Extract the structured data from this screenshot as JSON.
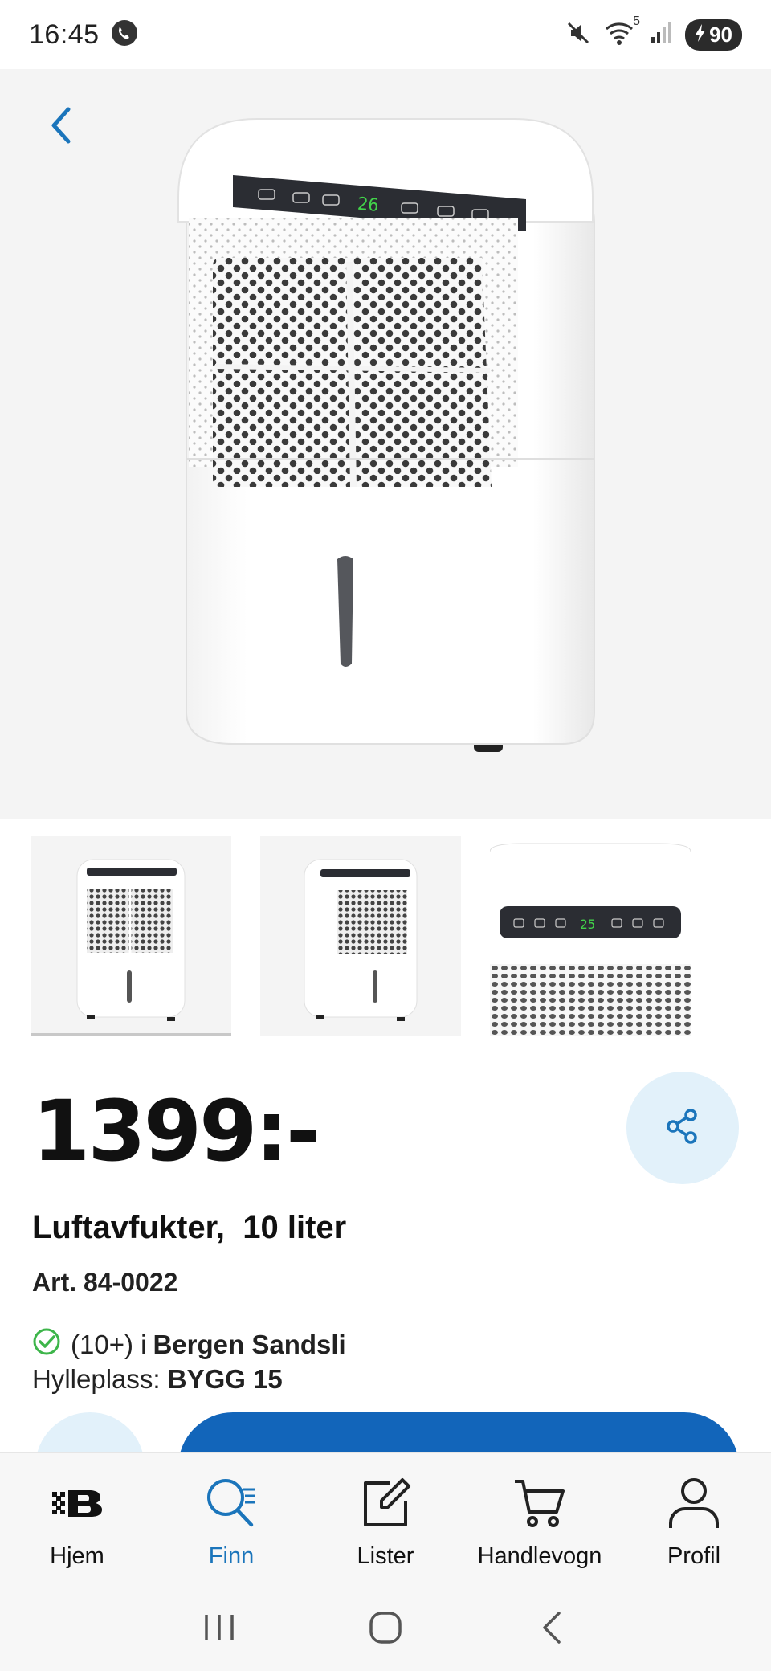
{
  "status_bar": {
    "time": "16:45",
    "signal_label": "5",
    "battery_level": "90",
    "icons": [
      "phone-call-icon",
      "mute-icon",
      "wifi-icon",
      "signal-icon",
      "battery-charging-icon"
    ]
  },
  "hero": {
    "panel_display": "26",
    "back_icon": "chevron-left-icon"
  },
  "thumbnails": [
    {
      "name": "thumbnail-front",
      "active": true
    },
    {
      "name": "thumbnail-side",
      "active": false
    },
    {
      "name": "thumbnail-panel-closeup",
      "active": false,
      "display": "25"
    }
  ],
  "product": {
    "price": "1399:-",
    "title": "Luftavfukter,  10 liter",
    "article": "Art. 84-0022",
    "stock_count": "(10+) i",
    "store": "Bergen Sandsli",
    "shelf_label": "Hylleplass:",
    "shelf_value": "BYGG 15"
  },
  "colors": {
    "primary": "#1265ba",
    "active_nav": "#1b75bb",
    "accent_light": "#e2f1fa",
    "in_stock_green": "#3db54a"
  },
  "bottom_nav": [
    {
      "label": "Hjem",
      "icon": "home-logo-icon",
      "active": false
    },
    {
      "label": "Finn",
      "icon": "search-list-icon",
      "active": true
    },
    {
      "label": "Lister",
      "icon": "edit-list-icon",
      "active": false
    },
    {
      "label": "Handlevogn",
      "icon": "cart-icon",
      "active": false
    },
    {
      "label": "Profil",
      "icon": "profile-icon",
      "active": false
    }
  ],
  "system_nav": [
    "recents-icon",
    "home-icon",
    "back-icon"
  ]
}
